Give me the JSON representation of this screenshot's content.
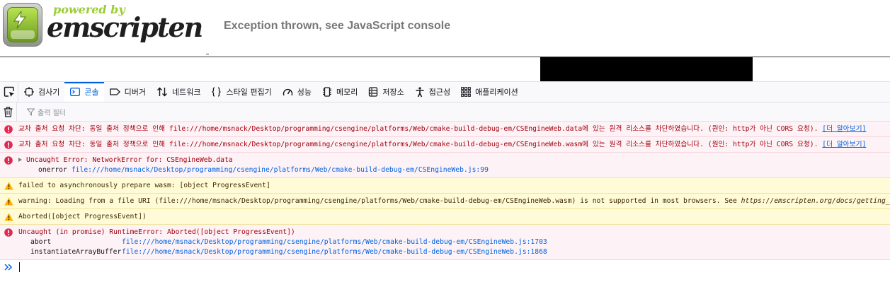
{
  "page": {
    "logo_powered": "powered by",
    "logo_name": "emscripten",
    "status": "Exception thrown, see JavaScript console"
  },
  "devtools": {
    "tabs": [
      {
        "label": "검사기",
        "icon": "inspector-icon"
      },
      {
        "label": "콘솔",
        "icon": "console-icon",
        "selected": true
      },
      {
        "label": "디버거",
        "icon": "debugger-icon"
      },
      {
        "label": "네트워크",
        "icon": "network-icon"
      },
      {
        "label": "스타일 편집기",
        "icon": "style-editor-icon"
      },
      {
        "label": "성능",
        "icon": "performance-icon"
      },
      {
        "label": "메모리",
        "icon": "memory-icon"
      },
      {
        "label": "저장소",
        "icon": "storage-icon"
      },
      {
        "label": "접근성",
        "icon": "accessibility-icon"
      },
      {
        "label": "애플리케이션",
        "icon": "application-icon"
      }
    ],
    "filter_placeholder": "출력 필터",
    "colors": {
      "accent": "#0061e0",
      "error_bg": "#fdf2f5",
      "error_text": "#a4000f",
      "warning_bg": "#fffbd6",
      "warning_text": "#3e2800"
    }
  },
  "messages": {
    "m1": {
      "text": "교차 출처 요청 차단: 동일 출처 정책으로 인해 file:///home/msnack/Desktop/programming/csengine/platforms/Web/cmake-build-debug-em/CSEngineWeb.data에 있는 원격 리소스를 차단하였습니다. (원인: http가 아닌 CORS 요청). ",
      "link": "[더 알아보기]"
    },
    "m2": {
      "text": "교차 출처 요청 차단: 동일 출처 정책으로 인해 file:///home/msnack/Desktop/programming/csengine/platforms/Web/cmake-build-debug-em/CSEngineWeb.wasm에 있는 원격 리소스를 차단하였습니다. (원인: http가 아닌 CORS 요청). ",
      "link": "[더 알아보기]"
    },
    "m3": {
      "text": "Uncaught Error: NetworkError for: CSEngineWeb.data",
      "frame_fn": "onerror",
      "frame_url": "file:///home/msnack/Desktop/programming/csengine/platforms/Web/cmake-build-debug-em/CSEngineWeb.js",
      "frame_line": ":99"
    },
    "m4": {
      "text": "failed to asynchronously prepare wasm: [object ProgressEvent]"
    },
    "m5": {
      "text": "warning: Loading from a file URI (file:///home/msnack/Desktop/programming/csengine/platforms/Web/cmake-build-debug-em/CSEngineWeb.wasm) is not supported in most browsers. See ",
      "link": "https://emscripten.org/docs/getting_started/FAQ.html"
    },
    "m6": {
      "text": "Aborted([object ProgressEvent])"
    },
    "m7": {
      "text": "Uncaught (in promise) RuntimeError: Aborted([object ProgressEvent])",
      "frames": [
        {
          "fn": "abort",
          "url": "file:///home/msnack/Desktop/programming/csengine/platforms/Web/cmake-build-debug-em/CSEngineWeb.js",
          "line": ":1703"
        },
        {
          "fn": "instantiateArrayBuffer",
          "url": "file:///home/msnack/Desktop/programming/csengine/platforms/Web/cmake-build-debug-em/CSEngineWeb.js",
          "line": ":1868"
        }
      ]
    }
  }
}
